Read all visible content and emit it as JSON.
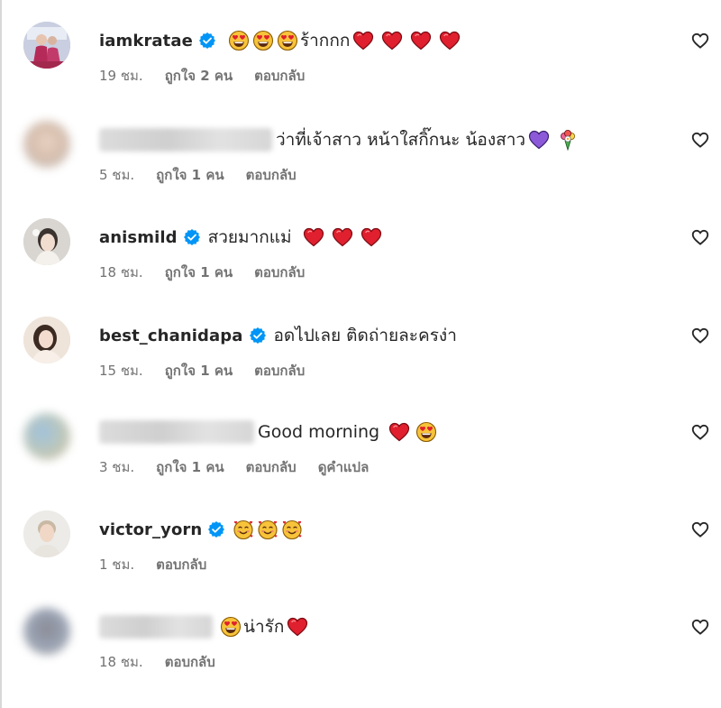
{
  "comments": [
    {
      "username": "iamkratae",
      "verified": true,
      "text": "ร้ากกก",
      "time": "19 ชม.",
      "likes": "ถูกใจ 2 คน",
      "reply": "ตอบกลับ"
    },
    {
      "username": "",
      "verified": false,
      "text": "ว่าที่เจ้าสาว หน้าใสกิ๊กนะ น้องสาว",
      "time": "5 ชม.",
      "likes": "ถูกใจ 1 คน",
      "reply": "ตอบกลับ"
    },
    {
      "username": "anismild",
      "verified": true,
      "text": "สวยมากแม่",
      "time": "18 ชม.",
      "likes": "ถูกใจ 1 คน",
      "reply": "ตอบกลับ"
    },
    {
      "username": "best_chanidapa",
      "verified": true,
      "text": "อดไปเลย ติดถ่ายละครง่า",
      "time": "15 ชม.",
      "likes": "ถูกใจ 1 คน",
      "reply": "ตอบกลับ"
    },
    {
      "username": "",
      "verified": false,
      "text": "Good morning",
      "time": "3 ชม.",
      "likes": "ถูกใจ 1 คน",
      "reply": "ตอบกลับ",
      "translate": "ดูคำแปล"
    },
    {
      "username": "victor_yorn",
      "verified": true,
      "text": "",
      "time": "1 ชม.",
      "reply": "ตอบกลับ"
    },
    {
      "username": "",
      "verified": false,
      "text": "น่ารัก",
      "time": "18 ชม.",
      "reply": "ตอบกลับ"
    }
  ],
  "icons": {
    "verified": "verified-badge-icon",
    "like": "heart-outline-icon",
    "heart_emoji": "red-heart-emoji",
    "love_eyes_emoji": "heart-eyes-emoji",
    "smiling_hearts_emoji": "smiling-face-with-hearts-emoji",
    "purple_heart_emoji": "purple-heart-emoji",
    "bouquet_emoji": "bouquet-emoji"
  },
  "colors": {
    "verified_blue": "#0095f6",
    "meta_text": "#737373",
    "heart_red": "#e0202e"
  }
}
